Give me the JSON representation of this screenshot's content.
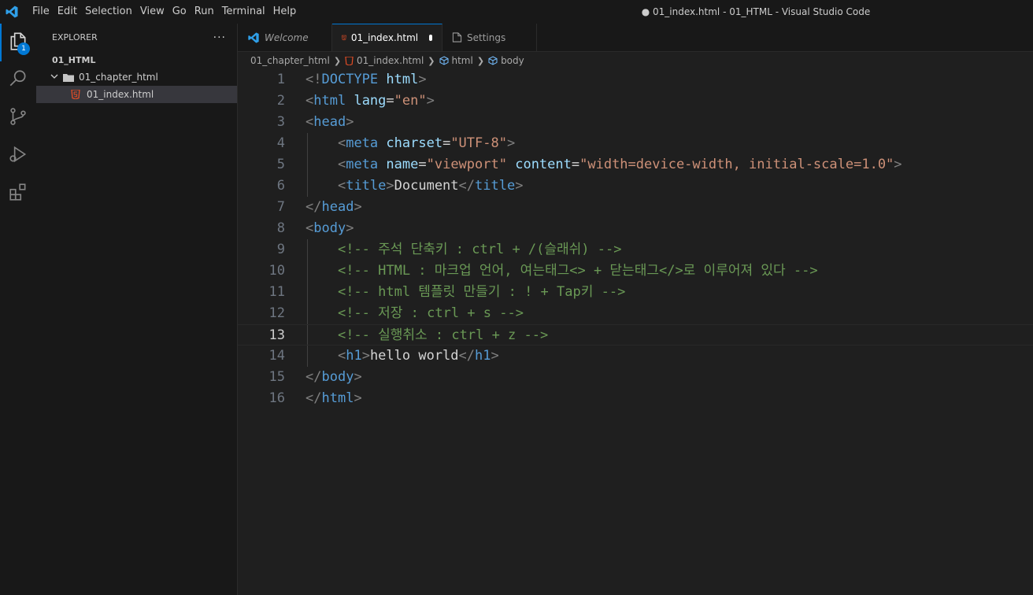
{
  "menu": [
    "File",
    "Edit",
    "Selection",
    "View",
    "Go",
    "Run",
    "Terminal",
    "Help"
  ],
  "window_title": "● 01_index.html - 01_HTML - Visual Studio Code",
  "activity": {
    "explorer_badge": "1"
  },
  "sidebar": {
    "title": "EXPLORER",
    "more": "···",
    "root": "01_HTML",
    "folder": "01_chapter_html",
    "file": "01_index.html"
  },
  "tabs": [
    {
      "label": "Welcome"
    },
    {
      "label": "01_index.html"
    },
    {
      "label": "Settings"
    }
  ],
  "breadcrumb": [
    "01_chapter_html",
    "01_index.html",
    "html",
    "body"
  ],
  "editor": {
    "current_line": 13,
    "lines": [
      {
        "n": "1",
        "tokens": [
          [
            "br",
            "<!"
          ],
          [
            "tag",
            "DOCTYPE"
          ],
          [
            "txt",
            " "
          ],
          [
            "attr",
            "html"
          ],
          [
            "br",
            ">"
          ]
        ]
      },
      {
        "n": "2",
        "tokens": [
          [
            "br",
            "<"
          ],
          [
            "tag",
            "html"
          ],
          [
            "txt",
            " "
          ],
          [
            "attr",
            "lang"
          ],
          [
            "txt",
            "="
          ],
          [
            "str",
            "\"en\""
          ],
          [
            "br",
            ">"
          ]
        ]
      },
      {
        "n": "3",
        "tokens": [
          [
            "br",
            "<"
          ],
          [
            "tag",
            "head"
          ],
          [
            "br",
            ">"
          ]
        ]
      },
      {
        "n": "4",
        "tokens": [
          [
            "txt",
            "    "
          ],
          [
            "br",
            "<"
          ],
          [
            "tag",
            "meta"
          ],
          [
            "txt",
            " "
          ],
          [
            "attr",
            "charset"
          ],
          [
            "txt",
            "="
          ],
          [
            "str",
            "\"UTF-8\""
          ],
          [
            "br",
            ">"
          ]
        ]
      },
      {
        "n": "5",
        "tokens": [
          [
            "txt",
            "    "
          ],
          [
            "br",
            "<"
          ],
          [
            "tag",
            "meta"
          ],
          [
            "txt",
            " "
          ],
          [
            "attr",
            "name"
          ],
          [
            "txt",
            "="
          ],
          [
            "str",
            "\"viewport\""
          ],
          [
            "txt",
            " "
          ],
          [
            "attr",
            "content"
          ],
          [
            "txt",
            "="
          ],
          [
            "str",
            "\"width=device-width, initial-scale=1.0\""
          ],
          [
            "br",
            ">"
          ]
        ]
      },
      {
        "n": "6",
        "tokens": [
          [
            "txt",
            "    "
          ],
          [
            "br",
            "<"
          ],
          [
            "tag",
            "title"
          ],
          [
            "br",
            ">"
          ],
          [
            "txt",
            "Document"
          ],
          [
            "br",
            "</"
          ],
          [
            "tag",
            "title"
          ],
          [
            "br",
            ">"
          ]
        ]
      },
      {
        "n": "7",
        "tokens": [
          [
            "br",
            "</"
          ],
          [
            "tag",
            "head"
          ],
          [
            "br",
            ">"
          ]
        ]
      },
      {
        "n": "8",
        "tokens": [
          [
            "br",
            "<"
          ],
          [
            "tag",
            "body"
          ],
          [
            "br",
            ">"
          ]
        ]
      },
      {
        "n": "9",
        "tokens": [
          [
            "txt",
            "    "
          ],
          [
            "cmt",
            "<!-- 주석 단축키 : ctrl + /(슬래쉬) -->"
          ]
        ]
      },
      {
        "n": "10",
        "tokens": [
          [
            "txt",
            "    "
          ],
          [
            "cmt",
            "<!-- HTML : 마크업 언어, 여는태그<> + 닫는태그</>로 이루어져 있다 -->"
          ]
        ]
      },
      {
        "n": "11",
        "tokens": [
          [
            "txt",
            "    "
          ],
          [
            "cmt",
            "<!-- html 템플릿 만들기 : ! + Tap키 -->"
          ]
        ]
      },
      {
        "n": "12",
        "tokens": [
          [
            "txt",
            "    "
          ],
          [
            "cmt",
            "<!-- 저장 : ctrl + s -->"
          ]
        ]
      },
      {
        "n": "13",
        "tokens": [
          [
            "txt",
            "    "
          ],
          [
            "cmt",
            "<!-- 실행취소 : ctrl + z -->"
          ]
        ]
      },
      {
        "n": "14",
        "tokens": [
          [
            "txt",
            "    "
          ],
          [
            "br",
            "<"
          ],
          [
            "tag",
            "h1"
          ],
          [
            "br",
            ">"
          ],
          [
            "txt",
            "hello world"
          ],
          [
            "br",
            "</"
          ],
          [
            "tag",
            "h1"
          ],
          [
            "br",
            ">"
          ]
        ]
      },
      {
        "n": "15",
        "tokens": [
          [
            "br",
            "</"
          ],
          [
            "tag",
            "body"
          ],
          [
            "br",
            ">"
          ]
        ]
      },
      {
        "n": "16",
        "tokens": [
          [
            "br",
            "</"
          ],
          [
            "tag",
            "html"
          ],
          [
            "br",
            ">"
          ]
        ]
      }
    ]
  },
  "colors": {
    "accent": "#0078d4",
    "tag": "#569cd6",
    "attribute": "#9cdcfe",
    "string": "#ce9178",
    "comment": "#6a9955",
    "html_icon": "#e44d26"
  },
  "icons": [
    "vscode-logo-icon",
    "files-icon",
    "search-icon",
    "source-control-icon",
    "run-debug-icon",
    "extensions-icon",
    "folder-icon",
    "html5-icon",
    "settings-file-icon",
    "symbol-icon"
  ]
}
